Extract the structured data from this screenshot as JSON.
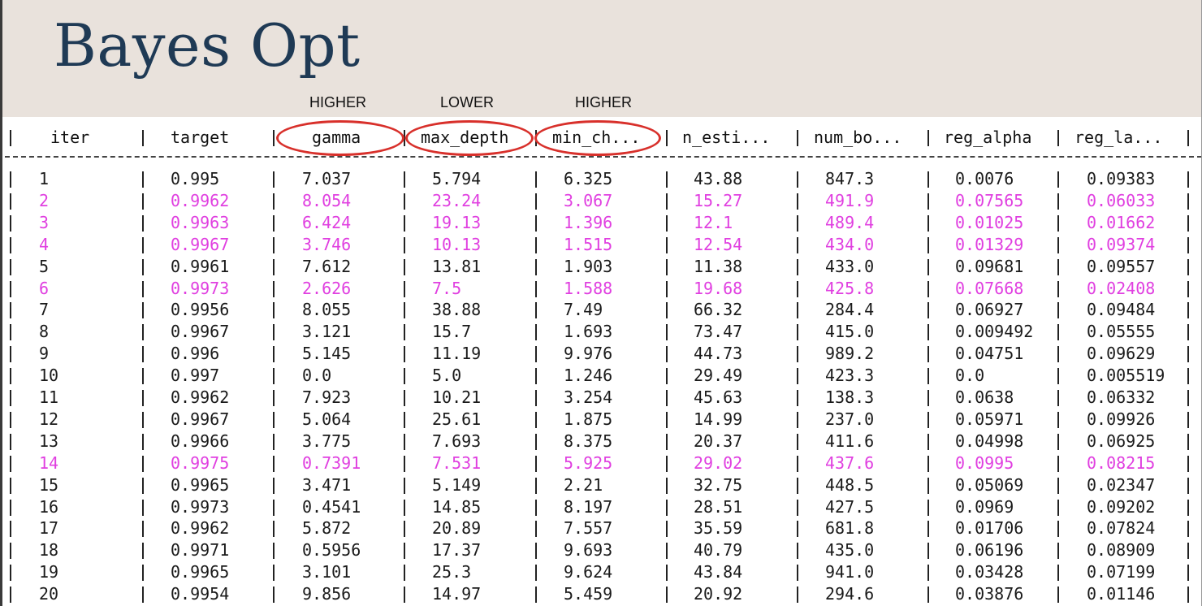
{
  "title": "Bayes Opt",
  "hints": [
    "HIGHER",
    "LOWER",
    "HIGHER"
  ],
  "columns": [
    "iter",
    "target",
    "gamma",
    "max_depth",
    "min_ch...",
    "n_esti...",
    "num_bo...",
    "reg_alpha",
    "reg_la..."
  ],
  "highlight_color": "#e03fe0",
  "circle_color": "#d8302b",
  "rows": [
    {
      "iter": "1",
      "target": "0.995",
      "gamma": "7.037",
      "max_depth": "5.794",
      "min_ch": "6.325",
      "n_esti": "43.88",
      "num_bo": "847.3",
      "reg_alpha": "0.0076",
      "reg_la": "0.09383",
      "hl": false
    },
    {
      "iter": "2",
      "target": "0.9962",
      "gamma": "8.054",
      "max_depth": "23.24",
      "min_ch": "3.067",
      "n_esti": "15.27",
      "num_bo": "491.9",
      "reg_alpha": "0.07565",
      "reg_la": "0.06033",
      "hl": true
    },
    {
      "iter": "3",
      "target": "0.9963",
      "gamma": "6.424",
      "max_depth": "19.13",
      "min_ch": "1.396",
      "n_esti": "12.1",
      "num_bo": "489.4",
      "reg_alpha": "0.01025",
      "reg_la": "0.01662",
      "hl": true
    },
    {
      "iter": "4",
      "target": "0.9967",
      "gamma": "3.746",
      "max_depth": "10.13",
      "min_ch": "1.515",
      "n_esti": "12.54",
      "num_bo": "434.0",
      "reg_alpha": "0.01329",
      "reg_la": "0.09374",
      "hl": true
    },
    {
      "iter": "5",
      "target": "0.9961",
      "gamma": "7.612",
      "max_depth": "13.81",
      "min_ch": "1.903",
      "n_esti": "11.38",
      "num_bo": "433.0",
      "reg_alpha": "0.09681",
      "reg_la": "0.09557",
      "hl": false
    },
    {
      "iter": "6",
      "target": "0.9973",
      "gamma": "2.626",
      "max_depth": "7.5",
      "min_ch": "1.588",
      "n_esti": "19.68",
      "num_bo": "425.8",
      "reg_alpha": "0.07668",
      "reg_la": "0.02408",
      "hl": true
    },
    {
      "iter": "7",
      "target": "0.9956",
      "gamma": "8.055",
      "max_depth": "38.88",
      "min_ch": "7.49",
      "n_esti": "66.32",
      "num_bo": "284.4",
      "reg_alpha": "0.06927",
      "reg_la": "0.09484",
      "hl": false
    },
    {
      "iter": "8",
      "target": "0.9967",
      "gamma": "3.121",
      "max_depth": "15.7",
      "min_ch": "1.693",
      "n_esti": "73.47",
      "num_bo": "415.0",
      "reg_alpha": "0.009492",
      "reg_la": "0.05555",
      "hl": false
    },
    {
      "iter": "9",
      "target": "0.996",
      "gamma": "5.145",
      "max_depth": "11.19",
      "min_ch": "9.976",
      "n_esti": "44.73",
      "num_bo": "989.2",
      "reg_alpha": "0.04751",
      "reg_la": "0.09629",
      "hl": false
    },
    {
      "iter": "10",
      "target": "0.997",
      "gamma": "0.0",
      "max_depth": "5.0",
      "min_ch": "1.246",
      "n_esti": "29.49",
      "num_bo": "423.3",
      "reg_alpha": "0.0",
      "reg_la": "0.005519",
      "hl": false
    },
    {
      "iter": "11",
      "target": "0.9962",
      "gamma": "7.923",
      "max_depth": "10.21",
      "min_ch": "3.254",
      "n_esti": "45.63",
      "num_bo": "138.3",
      "reg_alpha": "0.0638",
      "reg_la": "0.06332",
      "hl": false
    },
    {
      "iter": "12",
      "target": "0.9967",
      "gamma": "5.064",
      "max_depth": "25.61",
      "min_ch": "1.875",
      "n_esti": "14.99",
      "num_bo": "237.0",
      "reg_alpha": "0.05971",
      "reg_la": "0.09926",
      "hl": false
    },
    {
      "iter": "13",
      "target": "0.9966",
      "gamma": "3.775",
      "max_depth": "7.693",
      "min_ch": "8.375",
      "n_esti": "20.37",
      "num_bo": "411.6",
      "reg_alpha": "0.04998",
      "reg_la": "0.06925",
      "hl": false
    },
    {
      "iter": "14",
      "target": "0.9975",
      "gamma": "0.7391",
      "max_depth": "7.531",
      "min_ch": "5.925",
      "n_esti": "29.02",
      "num_bo": "437.6",
      "reg_alpha": "0.0995",
      "reg_la": "0.08215",
      "hl": true
    },
    {
      "iter": "15",
      "target": "0.9965",
      "gamma": "3.471",
      "max_depth": "5.149",
      "min_ch": "2.21",
      "n_esti": "32.75",
      "num_bo": "448.5",
      "reg_alpha": "0.05069",
      "reg_la": "0.02347",
      "hl": false
    },
    {
      "iter": "16",
      "target": "0.9973",
      "gamma": "0.4541",
      "max_depth": "14.85",
      "min_ch": "8.197",
      "n_esti": "28.51",
      "num_bo": "427.5",
      "reg_alpha": "0.0969",
      "reg_la": "0.09202",
      "hl": false
    },
    {
      "iter": "17",
      "target": "0.9962",
      "gamma": "5.872",
      "max_depth": "20.89",
      "min_ch": "7.557",
      "n_esti": "35.59",
      "num_bo": "681.8",
      "reg_alpha": "0.01706",
      "reg_la": "0.07824",
      "hl": false
    },
    {
      "iter": "18",
      "target": "0.9971",
      "gamma": "0.5956",
      "max_depth": "17.37",
      "min_ch": "9.693",
      "n_esti": "40.79",
      "num_bo": "435.0",
      "reg_alpha": "0.06196",
      "reg_la": "0.08909",
      "hl": false
    },
    {
      "iter": "19",
      "target": "0.9965",
      "gamma": "3.101",
      "max_depth": "25.3",
      "min_ch": "9.624",
      "n_esti": "43.84",
      "num_bo": "941.0",
      "reg_alpha": "0.03428",
      "reg_la": "0.07199",
      "hl": false
    },
    {
      "iter": "20",
      "target": "0.9954",
      "gamma": "9.856",
      "max_depth": "14.97",
      "min_ch": "5.459",
      "n_esti": "20.92",
      "num_bo": "294.6",
      "reg_alpha": "0.03876",
      "reg_la": "0.01146",
      "hl": false
    }
  ]
}
